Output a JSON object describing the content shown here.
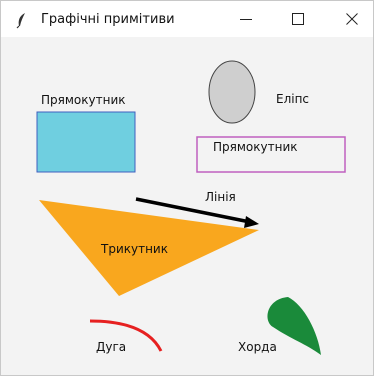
{
  "window": {
    "title": "Графічні примітиви",
    "controls": {
      "minimize": "minimize-icon",
      "maximize": "maximize-icon",
      "close": "close-icon"
    }
  },
  "canvas": {
    "labels": {
      "rectangle_filled": "Прямокутник",
      "ellipse": "Еліпс",
      "rectangle_outline": "Прямокутник",
      "line": "Лінія",
      "triangle": "Трикутник",
      "arc": "Дуга",
      "chord": "Хорда"
    },
    "colors": {
      "rect_fill": "#6fcfe0",
      "rect_border": "#3f5fbf",
      "ellipse_fill": "#cfcfcf",
      "outline_rect_border": "#c060c0",
      "line": "#000000",
      "triangle": "#f9a71e",
      "arc": "#e62020",
      "chord": "#1a8a3a"
    }
  }
}
